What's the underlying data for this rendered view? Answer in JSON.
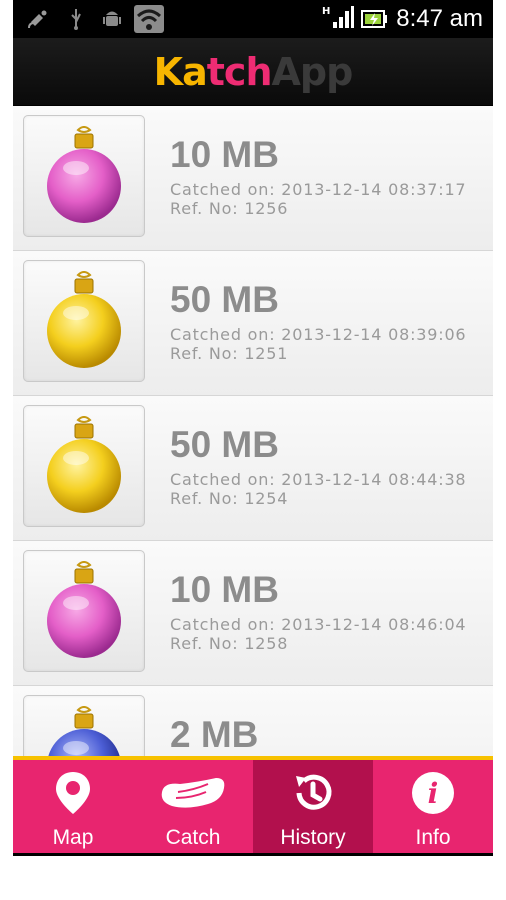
{
  "status_bar": {
    "icons": [
      "satellite-icon",
      "usb-icon",
      "android-debug-icon",
      "wifi-icon",
      "signal-icon",
      "battery-icon"
    ],
    "network_type": "H",
    "time": "8:47 am"
  },
  "title_bar": {
    "logo_part1": "Ka",
    "logo_part2": "tch",
    "logo_part3": "App"
  },
  "history": {
    "items": [
      {
        "size": "10 MB",
        "catched": "Catched on: 2013-12-14 08:37:17",
        "ref": "Ref. No: 1256",
        "ornament_color": "pink",
        "ornament": "pink-ornament-icon"
      },
      {
        "size": "50 MB",
        "catched": "Catched on: 2013-12-14 08:39:06",
        "ref": "Ref. No: 1251",
        "ornament_color": "gold",
        "ornament": "gold-ornament-icon"
      },
      {
        "size": "50 MB",
        "catched": "Catched on: 2013-12-14 08:44:38",
        "ref": "Ref. No: 1254",
        "ornament_color": "gold",
        "ornament": "gold-ornament-icon"
      },
      {
        "size": "10 MB",
        "catched": "Catched on: 2013-12-14 08:46:04",
        "ref": "Ref. No: 1258",
        "ornament_color": "pink",
        "ornament": "pink-ornament-icon"
      },
      {
        "size": "2 MB",
        "catched": "",
        "ref": "",
        "ornament_color": "blue",
        "ornament": "blue-ornament-icon"
      }
    ]
  },
  "tabs": [
    {
      "label": "Map",
      "icon": "map-pin-icon",
      "active": false
    },
    {
      "label": "Catch",
      "icon": "catch-hand-icon",
      "active": false
    },
    {
      "label": "History",
      "icon": "history-icon",
      "active": true
    },
    {
      "label": "Info",
      "icon": "info-icon",
      "active": false
    }
  ],
  "colors": {
    "accent": "#e8256f",
    "accent_active": "#b2104d",
    "tab_border": "#f7c100",
    "logo_yellow": "#f7b500",
    "logo_pink": "#ee2c73"
  }
}
